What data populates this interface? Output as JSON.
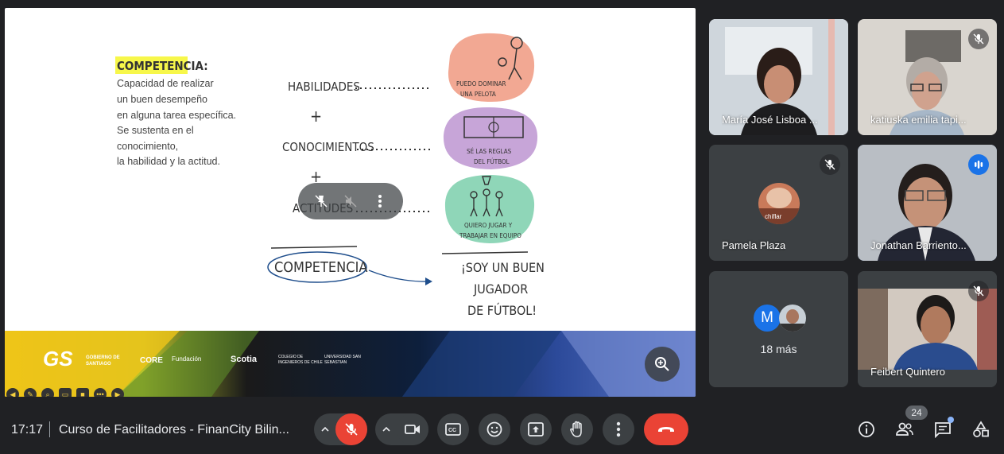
{
  "slide": {
    "competencia_heading": "COMPETENCIA:",
    "definition_lines": [
      "Capacidad de realizar",
      "un buen desempeño",
      "en alguna tarea específica.",
      "Se sustenta en el",
      "conocimiento,",
      "la habilidad y la actitud."
    ],
    "habilidades": "HABILIDADES",
    "conocimientos": "CONOCIMIENTOS",
    "actitudes": "ACTITUDES",
    "plus": "+",
    "blob1_text": [
      "PUEDO DOMINAR",
      "UNA PELOTA"
    ],
    "blob2_text": [
      "SÉ LAS REGLAS",
      "DEL FÚTBOL"
    ],
    "blob3_text": [
      "QUIERO JUGAR Y",
      "TRABAJAR EN EQUIPO"
    ],
    "competencia_circled": "COMPETENCIA",
    "result_lines": [
      "¡SOY UN BUEN",
      "JUGADOR",
      "DE FÚTBOL!"
    ],
    "footer_logos": [
      "GS",
      "GOBIERNO DE SANTIAGO",
      "CORE",
      "Fundación",
      "Scotia",
      "COLEGIO DE INGENIEROS DE CHILE",
      "UNIVERSIDAD SAN SEBASTIAN"
    ]
  },
  "participants": [
    {
      "name": "María José Lisboa ...",
      "muted": false
    },
    {
      "name": "katiuska emilia tapi...",
      "muted": true
    },
    {
      "name": "Pamela Plaza",
      "muted": true,
      "avatar_caption": "chiflar"
    },
    {
      "name": "Jonathan Barriento...",
      "muted": false,
      "speaking": true
    },
    {
      "more_label": "18 más",
      "avatar_letter": "M"
    },
    {
      "name": "Feibert Quintero",
      "muted": true
    }
  ],
  "bottom_bar": {
    "time": "17:17",
    "title": "Curso de Facilitadores - FinanCity Bilin...",
    "participant_count": "24"
  },
  "colors": {
    "background": "#202124",
    "tile": "#3c4043",
    "end_call": "#ea4335",
    "mic_off": "#ea4335",
    "speaking_border": "#8ab4f8",
    "blob1": "#f2a893",
    "blob2": "#c7a5d8",
    "blob3": "#8fd6b8"
  },
  "icons": [
    "mic-off-icon",
    "camera-icon",
    "captions-icon",
    "emoji-icon",
    "present-icon",
    "raise-hand-icon",
    "more-options-icon",
    "end-call-icon",
    "info-icon",
    "people-icon",
    "chat-icon",
    "activities-icon",
    "zoom-in-icon"
  ]
}
